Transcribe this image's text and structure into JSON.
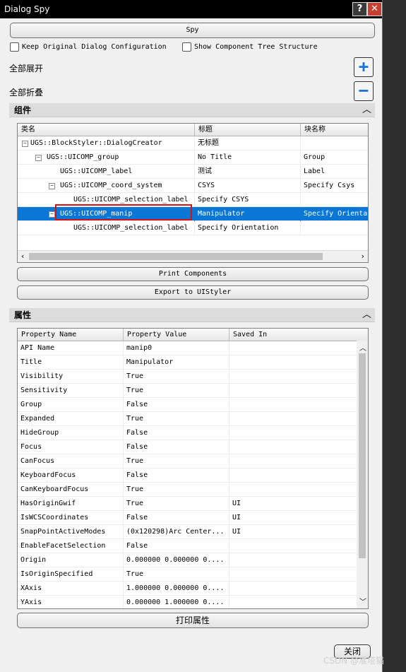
{
  "window": {
    "title": "Dialog Spy",
    "help_icon": "?",
    "close_icon": "✕"
  },
  "toolbar": {
    "spy_label": "Spy",
    "keep_original": "Keep Original Dialog Configuration",
    "show_tree": "Show Component Tree Structure",
    "expand_all": "全部展开",
    "collapse_all": "全部折叠"
  },
  "components_section": {
    "title": "组件",
    "columns": [
      "类名",
      "标题",
      "块名称"
    ],
    "rows": [
      {
        "name": "UGS::BlockStyler::DialogCreator",
        "title": "无标题",
        "block": ""
      },
      {
        "name": "UGS::UICOMP_group",
        "title": "No Title",
        "block": "Group"
      },
      {
        "name": "UGS::UICOMP_label",
        "title": "测试",
        "block": "Label"
      },
      {
        "name": "UGS::UICOMP_coord_system",
        "title": "CSYS",
        "block": "Specify Csys"
      },
      {
        "name": "UGS::UICOMP_selection_label",
        "title": "Specify CSYS",
        "block": ""
      },
      {
        "name": "UGS::UICOMP_manip",
        "title": "Manipulator",
        "block": "Specify Orienta"
      },
      {
        "name": "UGS::UICOMP_selection_label",
        "title": "Specify Orientation",
        "block": ""
      }
    ],
    "print_label": "Print Components",
    "export_label": "Export to UIStyler"
  },
  "properties_section": {
    "title": "属性",
    "columns": [
      "Property Name",
      "Property Value",
      "Saved In"
    ],
    "rows": [
      {
        "name": "API Name",
        "value": "manip0",
        "saved": ""
      },
      {
        "name": "Title",
        "value": "Manipulator",
        "saved": ""
      },
      {
        "name": "Visibility",
        "value": "True",
        "saved": ""
      },
      {
        "name": "Sensitivity",
        "value": "True",
        "saved": ""
      },
      {
        "name": "Group",
        "value": "False",
        "saved": ""
      },
      {
        "name": "Expanded",
        "value": "True",
        "saved": ""
      },
      {
        "name": "HideGroup",
        "value": "False",
        "saved": ""
      },
      {
        "name": "Focus",
        "value": "False",
        "saved": ""
      },
      {
        "name": "CanFocus",
        "value": "True",
        "saved": ""
      },
      {
        "name": "KeyboardFocus",
        "value": "False",
        "saved": ""
      },
      {
        "name": "CanKeyboardFocus",
        "value": "True",
        "saved": ""
      },
      {
        "name": "HasOriginGwif",
        "value": "True",
        "saved": "UI"
      },
      {
        "name": "IsWCSCoordinates",
        "value": "False",
        "saved": "UI"
      },
      {
        "name": "SnapPointActiveModes",
        "value": "(0x120298)Arc Center...",
        "saved": "UI"
      },
      {
        "name": "EnableFacetSelection",
        "value": "False",
        "saved": ""
      },
      {
        "name": "Origin",
        "value": "0.000000 0.000000 0....",
        "saved": ""
      },
      {
        "name": "IsOriginSpecified",
        "value": "True",
        "saved": ""
      },
      {
        "name": "XAxis",
        "value": "1.000000 0.000000 0....",
        "saved": ""
      },
      {
        "name": "YAxis",
        "value": "0.000000 1.000000 0....",
        "saved": ""
      }
    ],
    "print_label": "打印属性"
  },
  "footer": {
    "close_label": "关闭",
    "watermark": "CSDN @准塔猫"
  }
}
